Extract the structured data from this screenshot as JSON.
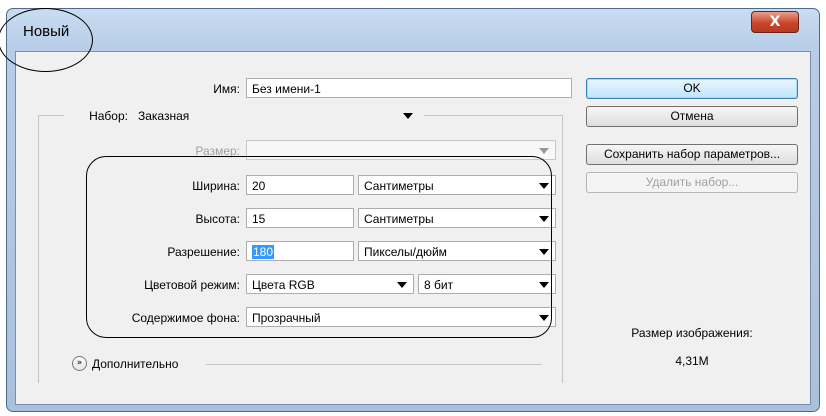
{
  "window": {
    "title": "Новый",
    "close_label": "X"
  },
  "name": {
    "label": "Имя:",
    "value": "Без имени-1"
  },
  "preset": {
    "label": "Набор:",
    "value": "Заказная"
  },
  "size": {
    "label": "Размер:",
    "value": ""
  },
  "width": {
    "label": "Ширина:",
    "value": "20",
    "unit": "Сантиметры"
  },
  "height": {
    "label": "Высота:",
    "value": "15",
    "unit": "Сантиметры"
  },
  "resolution": {
    "label": "Разрешение:",
    "value": "180",
    "unit": "Пикселы/дюйм"
  },
  "color_mode": {
    "label": "Цветовой режим:",
    "value": "Цвета RGB",
    "depth": "8 бит"
  },
  "background": {
    "label": "Содержимое фона:",
    "value": "Прозрачный"
  },
  "advanced": {
    "label": "Дополнительно",
    "icon": "double-chevron-down-icon"
  },
  "buttons": {
    "ok": "OK",
    "cancel": "Отмена",
    "save_preset": "Сохранить набор параметров...",
    "delete_preset": "Удалить набор..."
  },
  "image_size": {
    "label": "Размер изображения:",
    "value": "4,31М"
  },
  "colors": {
    "selection": "#3399ff",
    "close_button": "#c9462c",
    "default_button": "#bee6fd"
  }
}
